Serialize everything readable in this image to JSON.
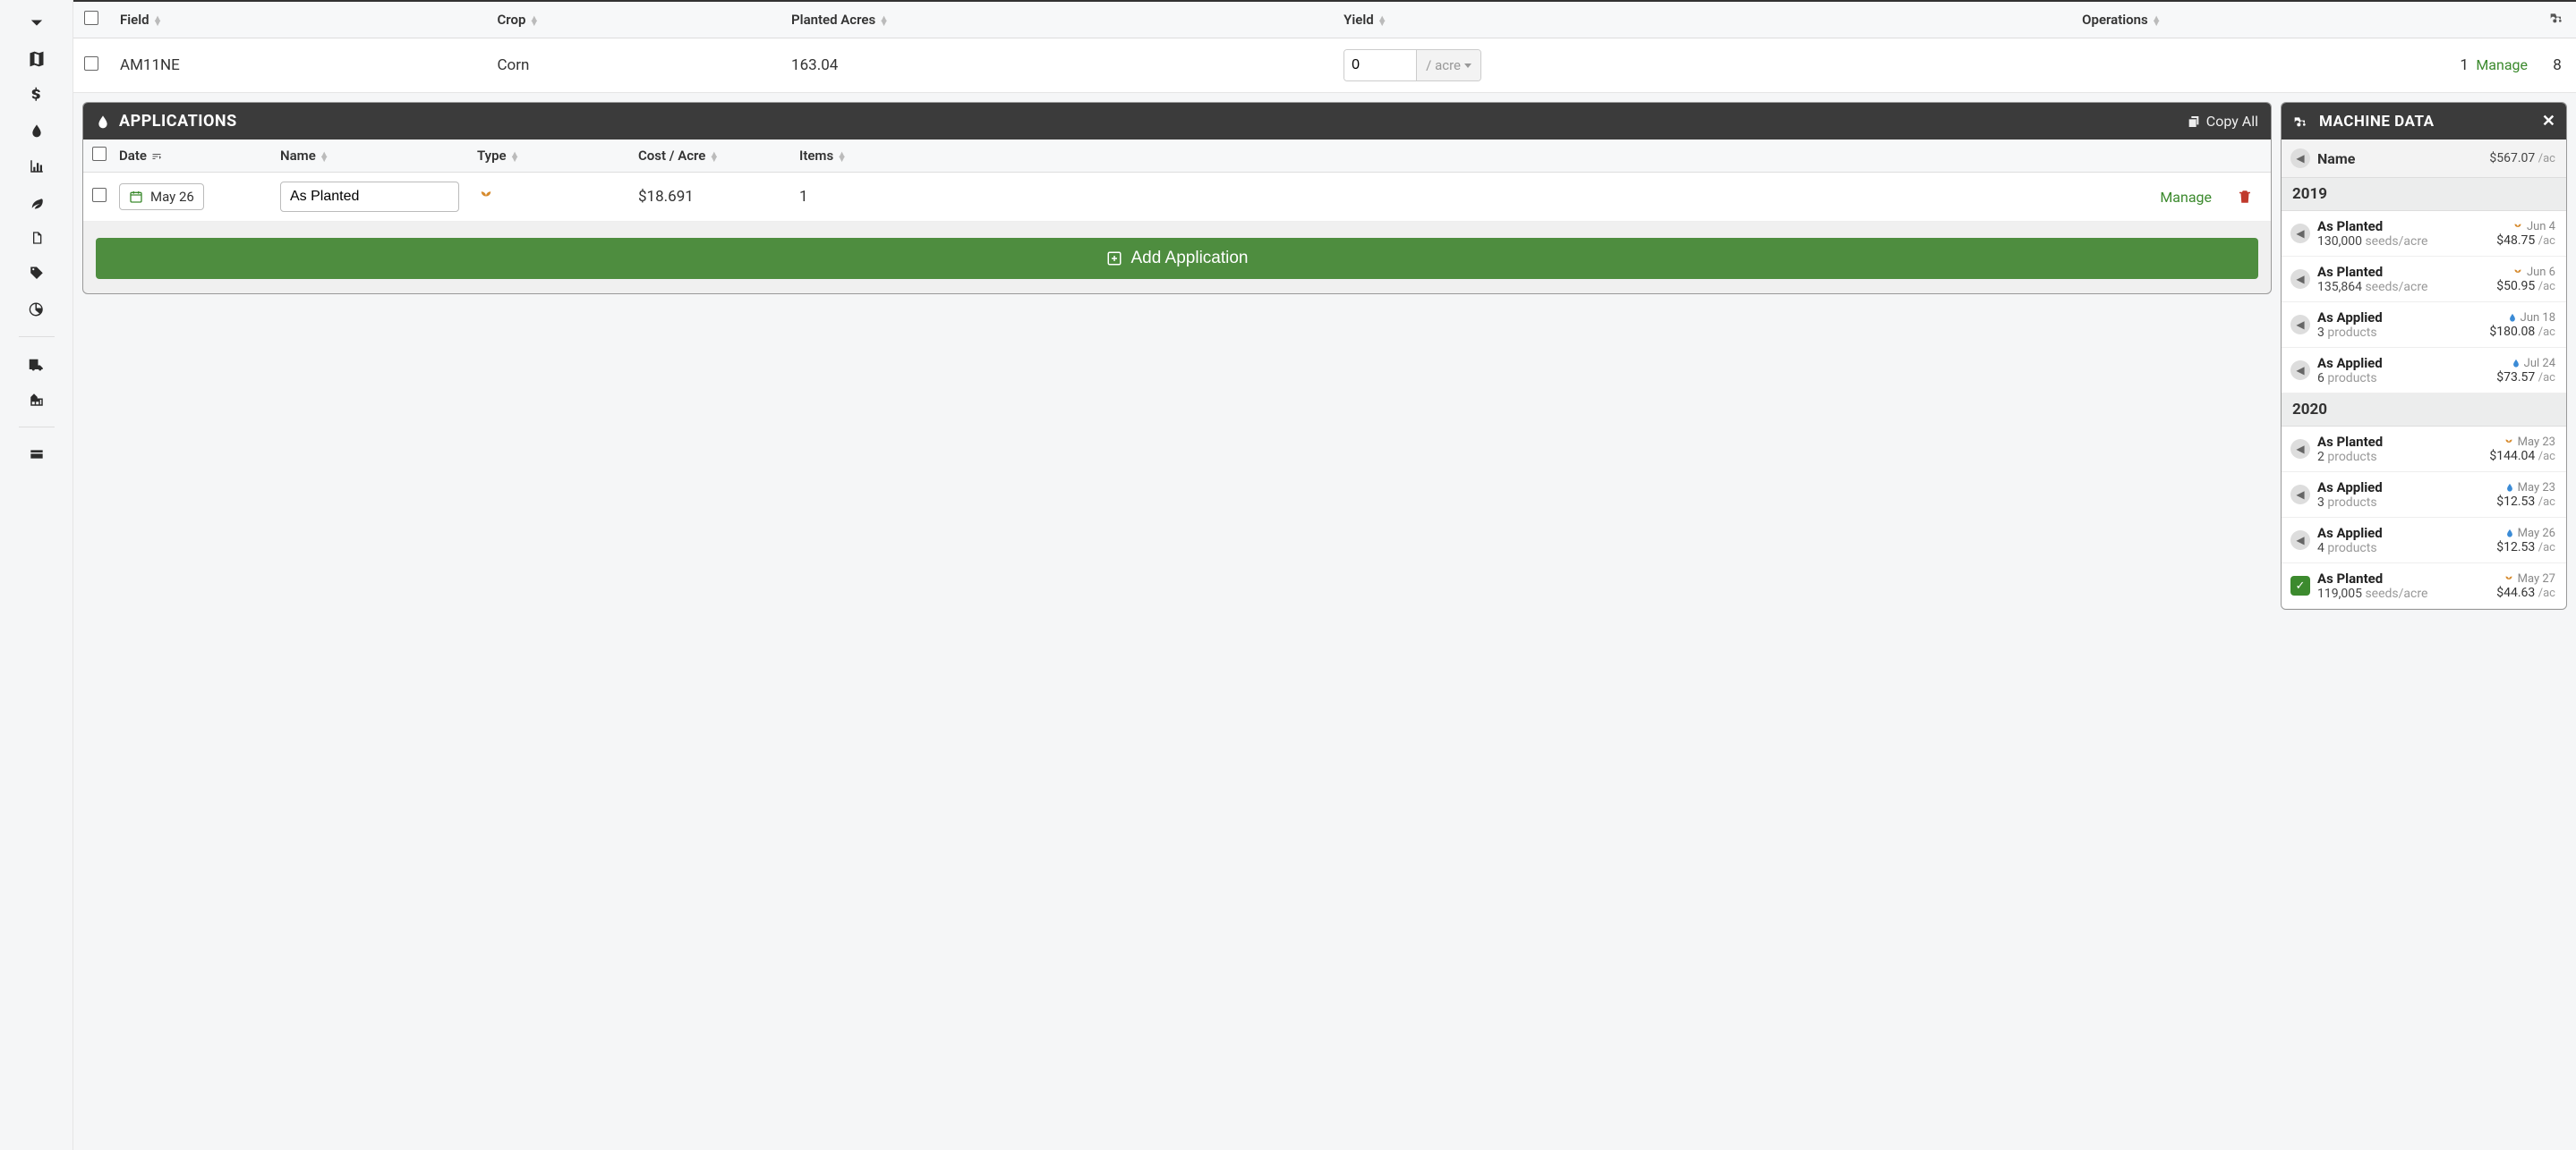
{
  "crop_table": {
    "headers": {
      "field": "Field",
      "crop": "Crop",
      "planted_acres": "Planted Acres",
      "yield": "Yield",
      "operations": "Operations"
    },
    "row": {
      "field": "AM11NE",
      "crop": "Corn",
      "planted_acres": "163.04",
      "yield_value": "0",
      "yield_unit": "/ acre",
      "operations_count": "1",
      "operations_manage": "Manage",
      "tractor_count": "8"
    }
  },
  "applications": {
    "title": "APPLICATIONS",
    "copy_all": "Copy All",
    "headers": {
      "date": "Date",
      "name": "Name",
      "type": "Type",
      "cost_per_acre": "Cost / Acre",
      "items": "Items"
    },
    "row": {
      "date": "May 26",
      "name": "As Planted",
      "cost": "$18.691",
      "items": "1",
      "manage": "Manage"
    },
    "add_button": "Add Application"
  },
  "machine_data": {
    "title": "MACHINE DATA",
    "name_header": "Name",
    "total": "$567.07",
    "total_unit": "/ac",
    "years": [
      {
        "year": "2019",
        "items": [
          {
            "type": "planted",
            "title": "As Planted",
            "sub_value": "130,000",
            "sub_unit": "seeds/acre",
            "date": "Jun 4",
            "cost": "$48.75",
            "cost_unit": "/ac",
            "icon": "sprout"
          },
          {
            "type": "planted",
            "title": "As Planted",
            "sub_value": "135,864",
            "sub_unit": "seeds/acre",
            "date": "Jun 6",
            "cost": "$50.95",
            "cost_unit": "/ac",
            "icon": "sprout"
          },
          {
            "type": "applied",
            "title": "As Applied",
            "sub_value": "3",
            "sub_unit": "products",
            "date": "Jun 18",
            "cost": "$180.08",
            "cost_unit": "/ac",
            "icon": "drop"
          },
          {
            "type": "applied",
            "title": "As Applied",
            "sub_value": "6",
            "sub_unit": "products",
            "date": "Jul 24",
            "cost": "$73.57",
            "cost_unit": "/ac",
            "icon": "drop"
          }
        ]
      },
      {
        "year": "2020",
        "items": [
          {
            "type": "planted",
            "title": "As Planted",
            "sub_value": "2",
            "sub_unit": "products",
            "date": "May 23",
            "cost": "$144.04",
            "cost_unit": "/ac",
            "icon": "sprout"
          },
          {
            "type": "applied",
            "title": "As Applied",
            "sub_value": "3",
            "sub_unit": "products",
            "date": "May 23",
            "cost": "$12.53",
            "cost_unit": "/ac",
            "icon": "drop"
          },
          {
            "type": "applied",
            "title": "As Applied",
            "sub_value": "4",
            "sub_unit": "products",
            "date": "May 26",
            "cost": "$12.53",
            "cost_unit": "/ac",
            "icon": "drop"
          },
          {
            "type": "planted",
            "title": "As Planted",
            "sub_value": "119,005",
            "sub_unit": "seeds/acre",
            "date": "May 27",
            "cost": "$44.63",
            "cost_unit": "/ac",
            "icon": "sprout",
            "checked": true
          }
        ]
      }
    ]
  }
}
